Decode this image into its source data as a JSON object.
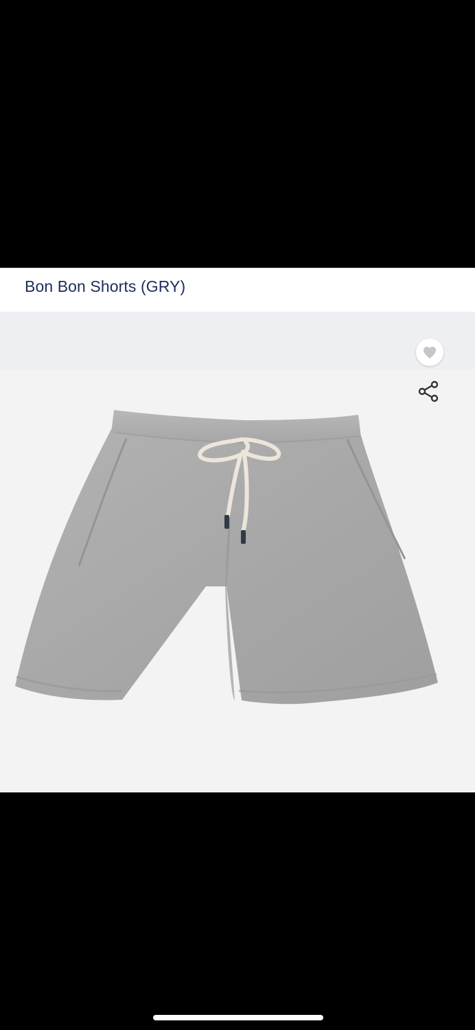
{
  "product": {
    "title": "Bon Bon Shorts (GRY)",
    "image_subject": "gray drawstring sweat shorts",
    "colors": {
      "title": "#1d2d5a",
      "fabric": "#a7a7a7",
      "drawstring": "#ece6da",
      "background": "#f3f3f4"
    }
  },
  "actions": {
    "wishlist_icon": "heart-icon",
    "share_icon": "share-icon"
  }
}
